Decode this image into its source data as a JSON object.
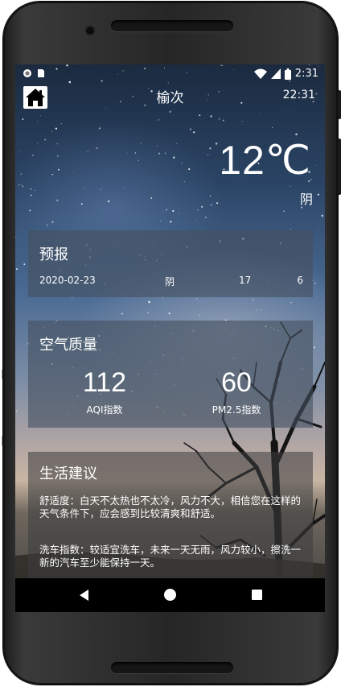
{
  "status_bar": {
    "time": "2:31",
    "icons": [
      "circle-notification-icon",
      "sim-card-icon",
      "wifi-icon",
      "signal-icon",
      "battery-icon"
    ]
  },
  "header": {
    "city": "榆次",
    "update_time": "22:31",
    "home_icon": "home-icon"
  },
  "now": {
    "temperature": "12℃",
    "condition": "阴"
  },
  "forecast": {
    "title": "预报",
    "items": [
      {
        "date": "2020-02-23",
        "info": "阴",
        "max": "17",
        "min": "6"
      }
    ]
  },
  "aqi": {
    "title": "空气质量",
    "aqi_value": "112",
    "aqi_label": "AQI指数",
    "pm25_value": "60",
    "pm25_label": "PM2.5指数"
  },
  "suggestion": {
    "title": "生活建议",
    "comfort": "舒适度：白天不太热也不太冷，风力不大，相信您在这样的天气条件下，应会感到比较清爽和舒适。",
    "car_wash": "洗车指数：较适宜洗车，未来一天无雨，风力较小，擦洗一新的汽车至少能保持一天。"
  },
  "navigation": {
    "back_icon": "back-triangle-icon",
    "home_icon": "home-circle-icon",
    "recents_icon": "recents-square-icon"
  }
}
